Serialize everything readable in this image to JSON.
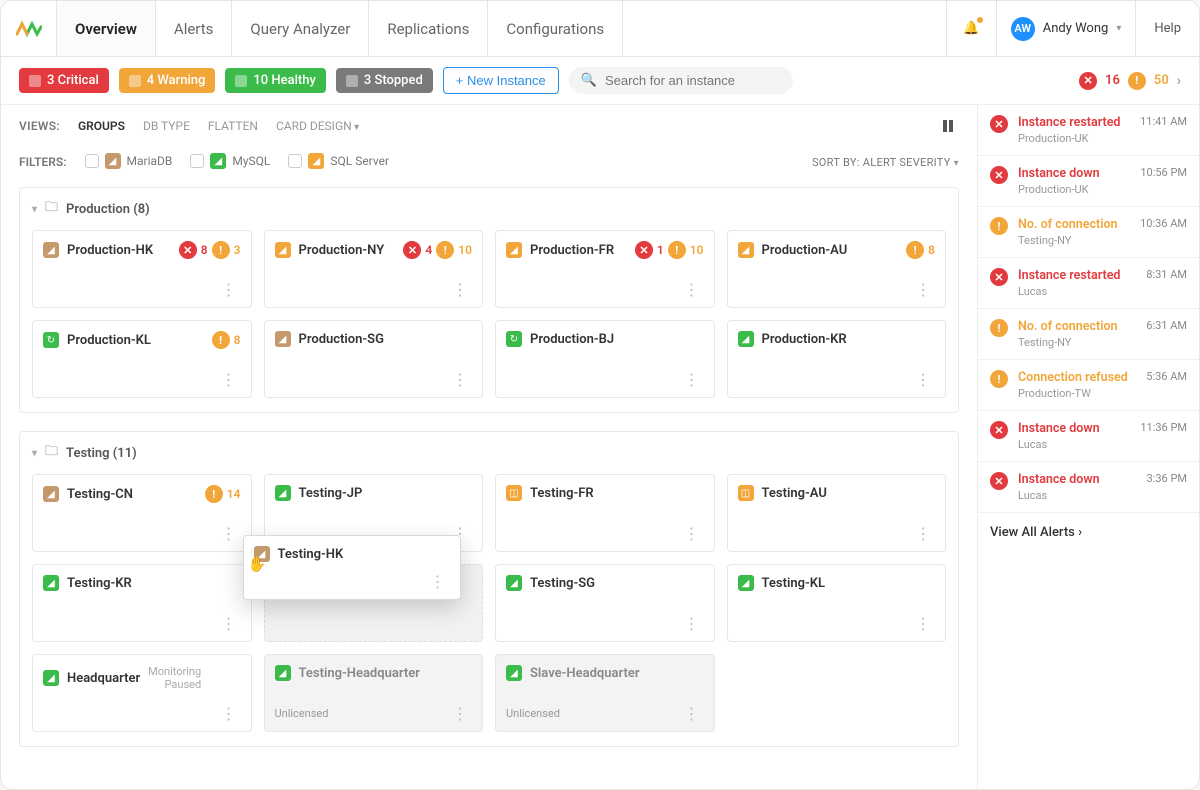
{
  "nav": {
    "tabs": [
      "Overview",
      "Alerts",
      "Query Analyzer",
      "Replications",
      "Configurations"
    ],
    "active": 0,
    "user_initials": "AW",
    "user_name": "Andy Wong",
    "help": "Help"
  },
  "status": {
    "critical": "3 Critical",
    "warning": "4 Warning",
    "healthy": "10 Healthy",
    "stopped": "3 Stopped",
    "new_instance": "+ New Instance",
    "search_placeholder": "Search for an instance",
    "count_critical": "16",
    "count_warning": "50"
  },
  "views": {
    "label": "VIEWS:",
    "opts": [
      "GROUPS",
      "DB TYPE",
      "FLATTEN",
      "CARD DESIGN"
    ],
    "active": 0
  },
  "filters": {
    "label": "FILTERS:",
    "items": [
      {
        "name": "MariaDB",
        "icon": "maria"
      },
      {
        "name": "MySQL",
        "icon": "mysql"
      },
      {
        "name": "SQL Server",
        "icon": "sql"
      }
    ],
    "sort": "SORT BY: ALERT SEVERITY"
  },
  "groups": [
    {
      "title": "Production (8)",
      "cards": [
        {
          "name": "Production-HK",
          "icon": "maria",
          "crit": "8",
          "warn": "3"
        },
        {
          "name": "Production-NY",
          "icon": "sql",
          "crit": "4",
          "warn": "10"
        },
        {
          "name": "Production-FR",
          "icon": "sql",
          "crit": "1",
          "warn": "10"
        },
        {
          "name": "Production-AU",
          "icon": "sql",
          "warn": "8"
        },
        {
          "name": "Production-KL",
          "icon": "other",
          "warn": "8"
        },
        {
          "name": "Production-SG",
          "icon": "maria"
        },
        {
          "name": "Production-BJ",
          "icon": "other"
        },
        {
          "name": "Production-KR",
          "icon": "mysql"
        }
      ]
    },
    {
      "title": "Testing (11)",
      "cards": [
        {
          "name": "Testing-CN",
          "icon": "maria",
          "warn": "14"
        },
        {
          "name": "Testing-JP",
          "icon": "mysql",
          "drag_target": true
        },
        {
          "name": "Testing-FR",
          "icon": "box"
        },
        {
          "name": "Testing-AU",
          "icon": "box"
        },
        {
          "name": "Testing-KR",
          "icon": "mysql"
        },
        {
          "ghost": true
        },
        {
          "name": "Testing-SG",
          "icon": "mysql"
        },
        {
          "name": "Testing-KL",
          "icon": "mysql"
        },
        {
          "name": "Headquarter",
          "icon": "mysql",
          "note": "Monitoring\nPaused"
        },
        {
          "name": "Testing-Headquarter",
          "icon": "mysql",
          "disabled": true,
          "foot": "Unlicensed"
        },
        {
          "name": "Slave-Headquarter",
          "icon": "mysql",
          "disabled": true,
          "foot": "Unlicensed"
        }
      ]
    }
  ],
  "drag": {
    "name": "Testing-HK",
    "icon": "maria"
  },
  "alerts": [
    {
      "sev": "red",
      "msg": "Instance restarted",
      "sub": "Production-UK",
      "time": "11:41 AM"
    },
    {
      "sev": "red",
      "msg": "Instance down",
      "sub": "Production-UK",
      "time": "10:56 PM"
    },
    {
      "sev": "yellow",
      "msg": "No. of connection",
      "sub": "Testing-NY",
      "time": "10:36 AM"
    },
    {
      "sev": "red",
      "msg": "Instance restarted",
      "sub": "Lucas",
      "time": "8:31 AM"
    },
    {
      "sev": "yellow",
      "msg": "No. of connection",
      "sub": "Testing-NY",
      "time": "6:31 AM"
    },
    {
      "sev": "yellow",
      "msg": "Connection refused",
      "sub": "Production-TW",
      "time": "5:36 AM"
    },
    {
      "sev": "red",
      "msg": "Instance down",
      "sub": "Lucas",
      "time": "11:36 PM"
    },
    {
      "sev": "red",
      "msg": "Instance down",
      "sub": "Lucas",
      "time": "3:36 PM"
    }
  ],
  "view_all": "View All Alerts"
}
